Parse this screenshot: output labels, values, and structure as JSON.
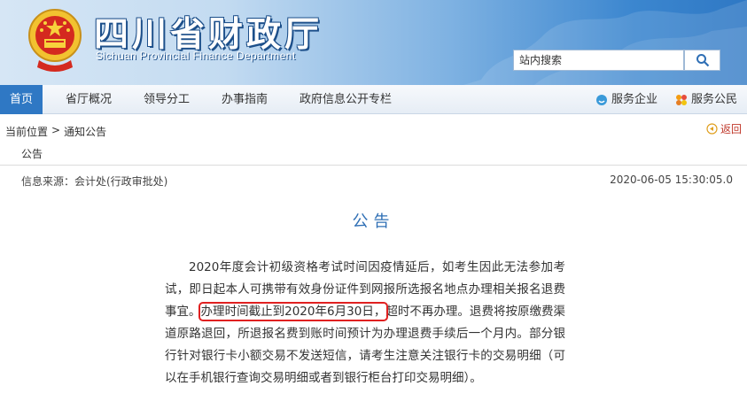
{
  "header": {
    "title": "四川省财政厅",
    "subtitle": "Sichuan  Provincial  Finance  Department",
    "search_placeholder": "站内搜索",
    "search_icon": "search-icon",
    "colors": {
      "banner_left": "#d6e6f5",
      "banner_right": "#2f78c4",
      "accent": "#2f78c4"
    }
  },
  "nav": {
    "items": [
      "首页",
      "省厅概况",
      "领导分工",
      "办事指南",
      "政府信息公开专栏"
    ],
    "service_enterprise": "服务企业",
    "service_public": "服务公民"
  },
  "breadcrumb": {
    "current": "当前位置",
    "separator": ">",
    "section": "通知公告",
    "back": "返回"
  },
  "meta": {
    "category": "公告",
    "source": "信息来源：会计处(行政审批处)",
    "date": "2020-06-05 15:30:05.0"
  },
  "article": {
    "title": "公告",
    "text_before": "2020年度会计初级资格考试时间因疫情延后，如考生因此无法参加考试，即日起本人可携带有效身份证件到网报所选报名地点办理相关报名退费事宜。",
    "highlight": "办理时间截止到2020年6月30日，",
    "text_after": "超时不再办理。退费将按原缴费渠道原路退回，所退报名费到账时间预计为办理退费手续后一个月内。部分银行针对银行卡小额交易不发送短信，请考生注意关注银行卡的交易明细（可以在手机银行查询交易明细或者到银行柜台打印交易明细）。",
    "highlight_color": "#e02020"
  }
}
